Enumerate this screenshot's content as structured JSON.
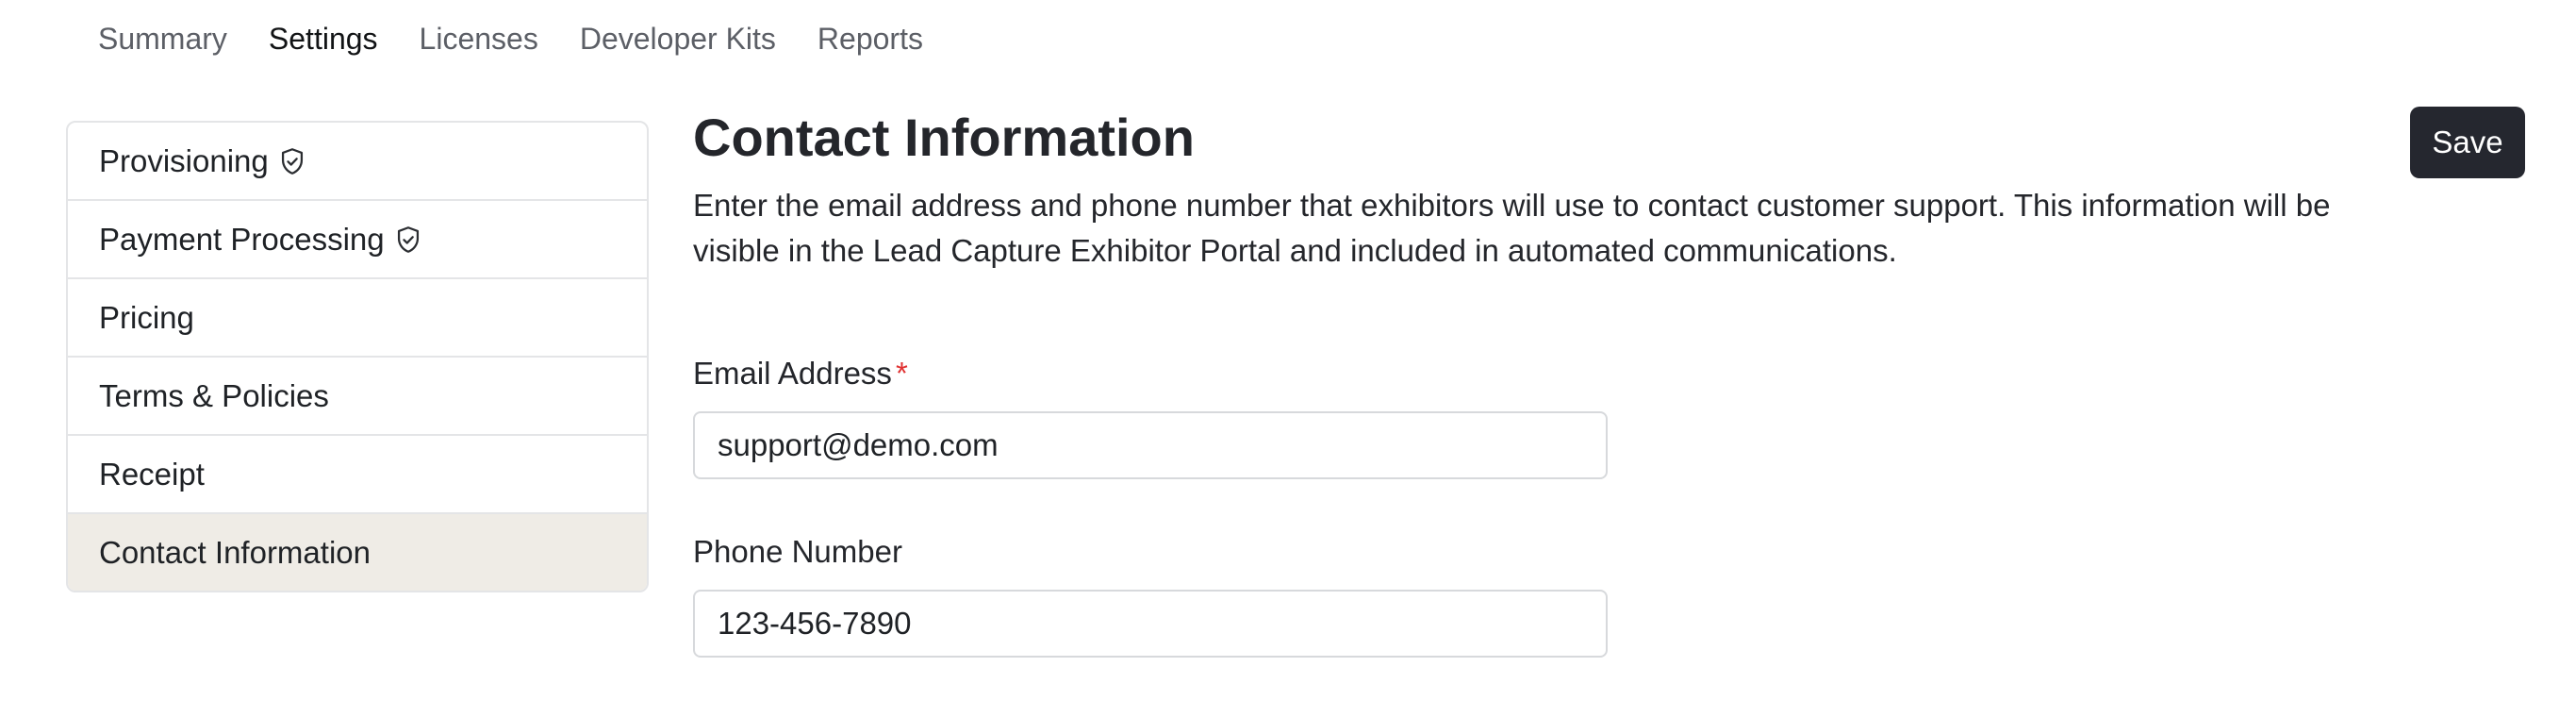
{
  "topnav": {
    "tabs": [
      {
        "label": "Summary"
      },
      {
        "label": "Settings"
      },
      {
        "label": "Licenses"
      },
      {
        "label": "Developer Kits"
      },
      {
        "label": "Reports"
      }
    ],
    "active": "Settings"
  },
  "sidebar": {
    "items": [
      {
        "label": "Provisioning",
        "icon": "shield-check-icon"
      },
      {
        "label": "Payment Processing",
        "icon": "shield-check-icon"
      },
      {
        "label": "Pricing"
      },
      {
        "label": "Terms & Policies"
      },
      {
        "label": "Receipt"
      },
      {
        "label": "Contact Information"
      }
    ],
    "active": "Contact Information"
  },
  "main": {
    "title": "Contact Information",
    "description": "Enter the email address and phone number that exhibitors will use to contact customer support. This information will be visible in the Lead Capture Exhibitor Portal and included in automated communications.",
    "save_label": "Save",
    "email": {
      "label": "Email Address",
      "required_marker": "*",
      "value": "support@demo.com"
    },
    "phone": {
      "label": "Phone Number",
      "value": "123-456-7890"
    }
  },
  "colors": {
    "active_sidebar_bg": "#efece6",
    "save_button_bg": "#25272f",
    "required_marker": "#e03131"
  }
}
